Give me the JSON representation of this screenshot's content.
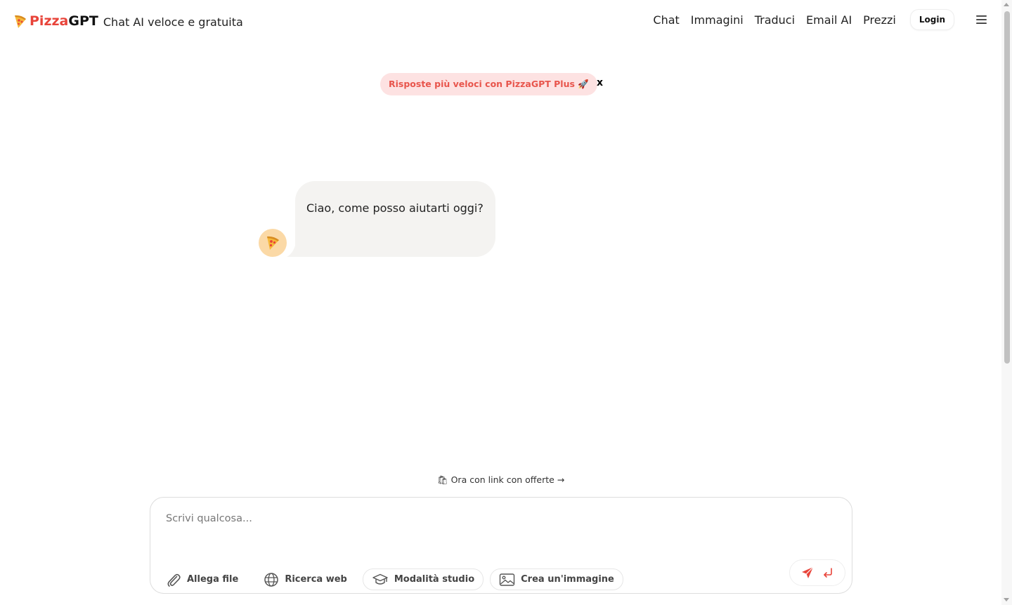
{
  "header": {
    "brand_pizza": "Pizza",
    "brand_gpt": "GPT",
    "tagline": "Chat AI veloce e gratuita",
    "nav": [
      "Chat",
      "Immagini",
      "Traduci",
      "Email AI",
      "Prezzi"
    ],
    "login": "Login"
  },
  "promo": {
    "text": "Risposte più veloci con PizzaGPT Plus 🚀",
    "close": "x"
  },
  "chat": {
    "greeting": "Ciao, come posso aiutarti oggi?",
    "avatar_icon": "pizza-icon"
  },
  "offer": {
    "text": "🛍 Ora con link con offerte →"
  },
  "composer": {
    "placeholder": "Scrivi qualcosa...",
    "value": "",
    "tools": [
      "Allega file",
      "Ricerca web",
      "Modalità studio",
      "Crea un'immagine"
    ]
  },
  "colors": {
    "brand_red": "#e8443a",
    "promo_bg": "#fde2e2",
    "bubble_bg": "#f4f3f1",
    "avatar_bg": "#fbd9a6"
  }
}
